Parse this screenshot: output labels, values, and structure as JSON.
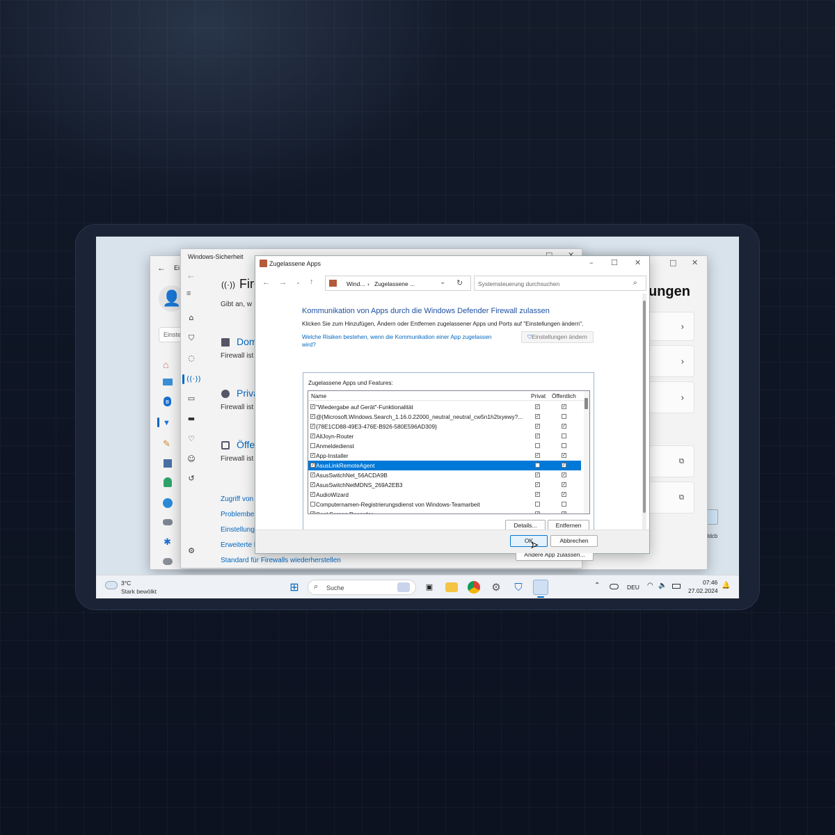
{
  "settings_window": {
    "title_partial": "Ei",
    "search_placeholder": "Einste",
    "heading_partial": "ungen",
    "controls": {
      "minimize": "–",
      "maximize": "□",
      "close": "✕"
    }
  },
  "security_window": {
    "title": "Windows-Sicherheit",
    "heading_partial": "Fire",
    "subtitle_partial": "Gibt an, w",
    "networks": [
      {
        "name_partial": "Dom",
        "status_partial": "Firewall ist"
      },
      {
        "name_partial": "Priva",
        "status_partial": "Firewall ist"
      },
      {
        "name_partial": "Öffe",
        "status_partial": "Firewall ist"
      }
    ],
    "links": [
      "Zugriff von",
      "Problembe",
      "Einstellung",
      "Erweiterte E",
      "Standard für Firewalls wiederherstellen"
    ]
  },
  "dialog": {
    "title": "Zugelassene Apps",
    "breadcrumb": [
      "Wind...",
      "Zugelassene ..."
    ],
    "search_placeholder": "Systemsteuerung durchsuchen",
    "heading": "Kommunikation von Apps durch die Windows Defender Firewall zulassen",
    "description": "Klicken Sie zum Hinzufügen, Ändern oder Entfernen zugelassener Apps und Ports auf \"Einstellungen ändern\".",
    "risk_link_line1": "Welche Risiken bestehen, wenn die Kommunikation einer App zugelassen",
    "risk_link_line2": "wird?",
    "change_settings_label": "Einstellungen ändern",
    "group_label": "Zugelassene Apps und Features:",
    "columns": {
      "name": "Name",
      "private": "Privat",
      "public": "Öffentlich"
    },
    "rows": [
      {
        "enabled": true,
        "name": "\"Wiedergabe auf Gerät\"-Funktionalität",
        "private": true,
        "public": true,
        "selected": false
      },
      {
        "enabled": true,
        "name": "@{Microsoft.Windows.Search_1.16.0.22000_neutral_neutral_cw5n1h2txyewy?...",
        "private": true,
        "public": false,
        "selected": false
      },
      {
        "enabled": true,
        "name": "{78E1CD88-49E3-476E-B926-580E596AD309}",
        "private": true,
        "public": true,
        "selected": false
      },
      {
        "enabled": true,
        "name": "AllJoyn-Router",
        "private": true,
        "public": false,
        "selected": false
      },
      {
        "enabled": false,
        "name": "Anmeldedienst",
        "private": false,
        "public": false,
        "selected": false
      },
      {
        "enabled": true,
        "name": "App-Installer",
        "private": true,
        "public": true,
        "selected": false
      },
      {
        "enabled": true,
        "name": "AsusLinkRemoteAgent",
        "private": false,
        "public": true,
        "selected": true
      },
      {
        "enabled": true,
        "name": "AsusSwitchNet_56ACDA9B",
        "private": true,
        "public": true,
        "selected": false
      },
      {
        "enabled": true,
        "name": "AsusSwitchNetMDNS_269A2EB3",
        "private": true,
        "public": true,
        "selected": false
      },
      {
        "enabled": true,
        "name": "AudioWizard",
        "private": true,
        "public": true,
        "selected": false
      },
      {
        "enabled": false,
        "name": "Computernamen-Registrierungsdienst von Windows-Teamarbeit",
        "private": false,
        "public": false,
        "selected": false
      },
      {
        "enabled": true,
        "name": "Cool Screen Recorder",
        "private": true,
        "public": true,
        "selected": false
      }
    ],
    "details_button": "Details...",
    "remove_button": "Entfernen",
    "allow_other_button": "Andere App zulassen...",
    "ok_button": "OK",
    "cancel_button": "Abbrechen"
  },
  "taskbar": {
    "weather_temp": "3°C",
    "weather_desc": "Stark bewölkt",
    "search_label": "Suche",
    "language": "DEU",
    "time": "07:46",
    "date": "27.02.2024"
  },
  "desktop": {
    "icon_label_partial": "ddcb"
  }
}
